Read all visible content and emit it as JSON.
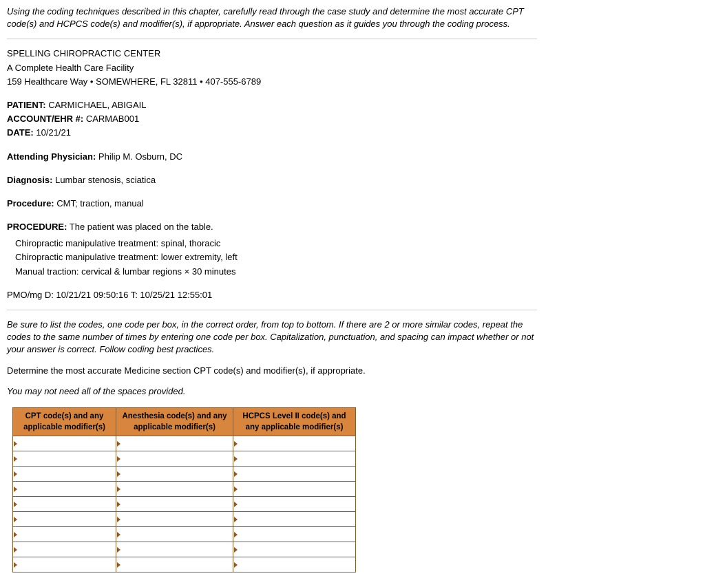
{
  "intro": "Using the coding techniques described in this chapter, carefully read through the case study and determine the most accurate CPT code(s) and HCPCS code(s) and modifier(s), if appropriate. Answer each question as it guides you through the coding process.",
  "facility": {
    "name": "SPELLING CHIROPRACTIC CENTER",
    "tagline": "A Complete Health Care Facility",
    "address": "159 Healthcare Way • SOMEWHERE, FL 32811 • 407-555-6789"
  },
  "labels": {
    "patient": "PATIENT:",
    "account": "ACCOUNT/EHR #:",
    "date": "DATE:",
    "attending": "Attending Physician:",
    "diagnosis": "Diagnosis:",
    "procedure_short": "Procedure:",
    "procedure_long": "PROCEDURE:"
  },
  "values": {
    "patient": "CARMICHAEL, ABIGAIL",
    "account": "CARMAB001",
    "date": "10/21/21",
    "attending": "Philip M. Osburn, DC",
    "diagnosis": "Lumbar stenosis, sciatica",
    "procedure_short": "CMT; traction, manual",
    "procedure_long": "The patient was placed on the table."
  },
  "procedure_lines": [
    "Chiropractic manipulative treatment: spinal, thoracic",
    "Chiropractic manipulative treatment: lower extremity, left",
    "Manual traction: cervical & lumbar regions × 30 minutes"
  ],
  "footer_line": "PMO/mg D: 10/21/21 09:50:16 T: 10/25/21 12:55:01",
  "note": "Be sure to list the codes, one code per box, in the correct order, from top to bottom. If there are 2 or more similar codes, repeat the codes to the same number of times by entering one code per box. Capitalization, punctuation, and spacing can impact whether or not your answer is correct. Follow coding best practices.",
  "question": "Determine the most accurate Medicine section CPT code(s) and modifier(s), if appropriate.",
  "hint": "You may not need all of the spaces provided.",
  "table": {
    "headers": [
      "CPT code(s) and any applicable modifier(s)",
      "Anesthesia code(s) and any applicable modifier(s)",
      "HCPCS Level II code(s) and any applicable modifier(s)"
    ],
    "rows": 9
  }
}
